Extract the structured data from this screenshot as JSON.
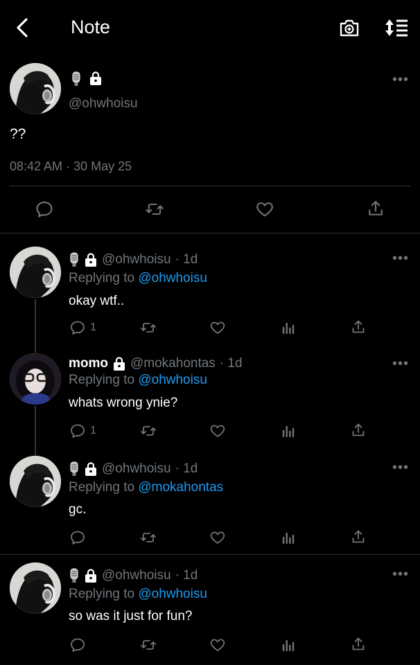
{
  "header": {
    "title": "Note"
  },
  "main_tweet": {
    "handle": "@ohwhoisu",
    "text": "??",
    "timestamp": "08:42 AM · 30 May 25"
  },
  "replies": [
    {
      "name_prefix": "",
      "handle": "@ohwhoisu",
      "age": "· 1d",
      "replying_label": "Replying to",
      "replying_to": "@ohwhoisu",
      "text": "okay wtf..",
      "reply_count": "1"
    },
    {
      "name_prefix": "momo",
      "handle": "@mokahontas",
      "age": "· 1d",
      "replying_label": "Replying to",
      "replying_to": "@ohwhoisu",
      "text": "whats wrong ynie?",
      "reply_count": "1"
    },
    {
      "name_prefix": "",
      "handle": "@ohwhoisu",
      "age": "· 1d",
      "replying_label": "Replying to",
      "replying_to": "@mokahontas",
      "text": "gc.",
      "reply_count": ""
    },
    {
      "name_prefix": "",
      "handle": "@ohwhoisu",
      "age": "· 1d",
      "replying_label": "Replying to",
      "replying_to": "@ohwhoisu",
      "text": "so was it just for fun?",
      "reply_count": ""
    }
  ],
  "more_label": "•••",
  "icons": [
    "back-arrow-icon",
    "camera-icon",
    "sort-icon",
    "microphone-emoji-icon",
    "lock-icon",
    "comment-icon",
    "retweet-icon",
    "heart-icon",
    "share-icon",
    "stats-icon"
  ],
  "colors": {
    "background": "#000000",
    "text": "#ffffff",
    "muted": "#71767b",
    "accent": "#1d9bf0",
    "divider": "#2f3336"
  }
}
